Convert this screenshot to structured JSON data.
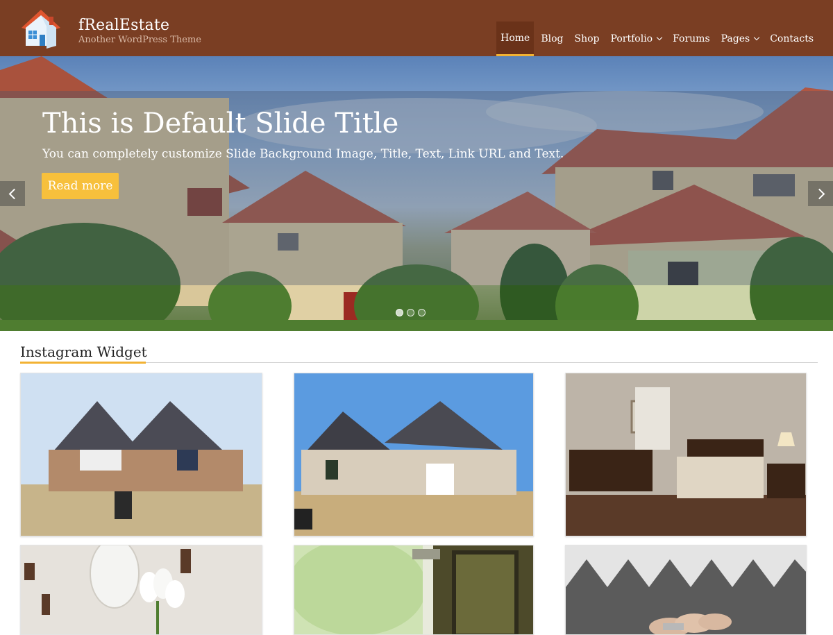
{
  "header": {
    "site_title": "fRealEstate",
    "tagline": "Another WordPress Theme",
    "logo_icon": "house-logo-icon",
    "colors": {
      "background": "#7a3e23",
      "active_background": "#6a3219",
      "accent": "#f2b233"
    }
  },
  "nav": {
    "items": [
      {
        "label": "Home",
        "active": true,
        "has_dropdown": false
      },
      {
        "label": "Blog",
        "active": false,
        "has_dropdown": false
      },
      {
        "label": "Shop",
        "active": false,
        "has_dropdown": false
      },
      {
        "label": "Portfolio",
        "active": false,
        "has_dropdown": true
      },
      {
        "label": "Forums",
        "active": false,
        "has_dropdown": false
      },
      {
        "label": "Pages",
        "active": false,
        "has_dropdown": true
      },
      {
        "label": "Contacts",
        "active": false,
        "has_dropdown": false
      }
    ]
  },
  "slider": {
    "title": "This is Default Slide Title",
    "text": "You can completely customize Slide Background Image, Title, Text, Link URL and Text.",
    "button_label": "Read more",
    "button_color": "#f7c03c",
    "prev_icon": "chevron-left-icon",
    "next_icon": "chevron-right-icon",
    "slide_count": 3,
    "active_slide": 1
  },
  "instagram": {
    "title": "Instagram Widget",
    "photos": [
      {
        "subject": "brick house with sold sign"
      },
      {
        "subject": "stone house with dark roof"
      },
      {
        "subject": "bedroom interior"
      },
      {
        "subject": "white tulips on shelf"
      },
      {
        "subject": "door with key"
      },
      {
        "subject": "hand holding key"
      }
    ]
  }
}
